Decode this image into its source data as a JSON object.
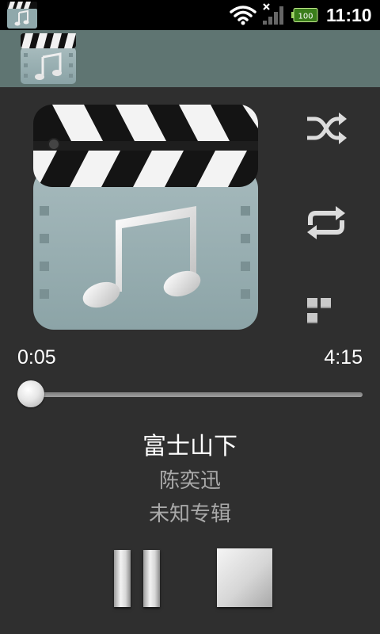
{
  "status_bar": {
    "time": "11:10",
    "battery_level": "100",
    "icons": [
      "media-player-icon",
      "wifi-icon",
      "signal-icon",
      "battery-icon"
    ]
  },
  "header": {
    "icon": "media-player-icon"
  },
  "player": {
    "album_art_icon": "clapperboard-music-icon",
    "controls": {
      "shuffle_icon": "shuffle-icon",
      "repeat_icon": "repeat-icon",
      "more_icon": "more-icon"
    },
    "elapsed": "0:05",
    "duration": "4:15",
    "progress_fraction": 0.02,
    "song_title": "富士山下",
    "artist": "陈奕迅",
    "album": "未知专辑",
    "buttons": {
      "pause_icon": "pause-icon",
      "stop_icon": "stop-icon"
    }
  },
  "colors": {
    "background": "#2f2f2f",
    "header": "#5f7572",
    "accent": "#f0a000",
    "secondary_text": "#a9a9a9"
  }
}
